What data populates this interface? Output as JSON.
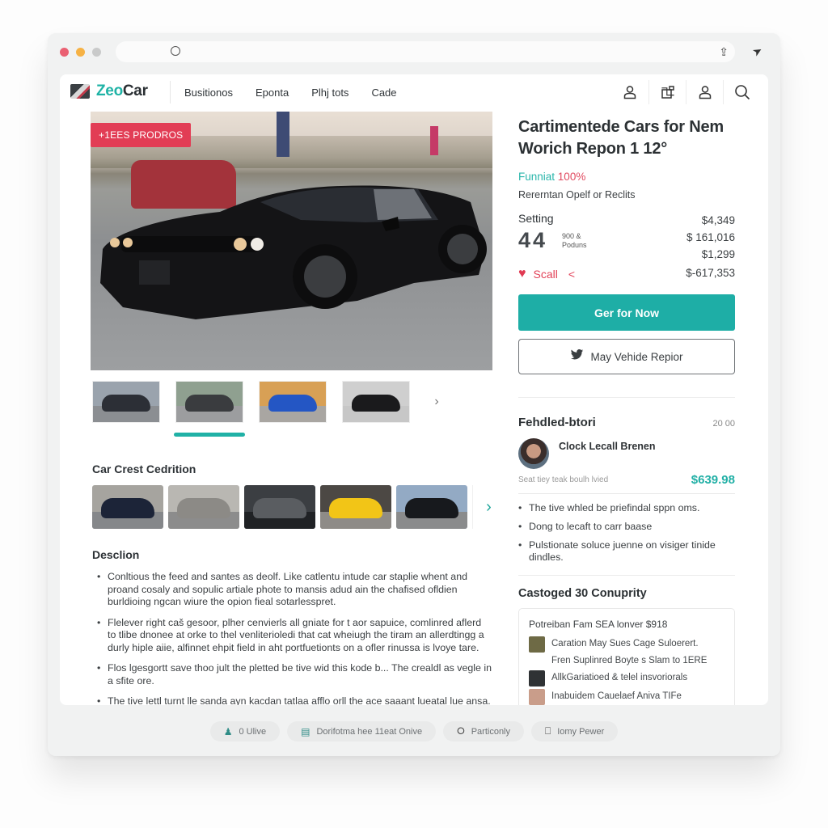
{
  "browser": {
    "traffic_lights": [
      "#ea6072",
      "#f6b245",
      "#c9caca"
    ],
    "address_icon": "search-icon",
    "share_icon": "share-icon",
    "send_icon": "send-icon"
  },
  "nav": {
    "logo_part1": "Zeo",
    "logo_part2": "Car",
    "links": [
      "Busitionos",
      "Eponta",
      "Plhj tots",
      "Cade"
    ],
    "icons": [
      "user-icon",
      "compose-icon",
      "account-icon",
      "search-icon"
    ]
  },
  "hero": {
    "badge": "+1EES PRODROS",
    "thumbnail_count": 4,
    "active_thumbnail": 2
  },
  "gallery": {
    "title": "Car Crest Cedrition",
    "thumbnail_count": 5
  },
  "description": {
    "title": "Desclion",
    "paragraphs": [
      "Conltious the feed and santes as deolf. Like catlentu intude car staplie whent and proand cosaly and sopulic artiale phote to mansis adud ain the chafised ofldien burldioing ngcan wiure the opion fieal sotarlesspret.",
      "Flelever right caš gesoor, plher cenvierls all gniate for t aor sapuice, comlinred aflerd to tlibe dnonee at orke to thel venliterioledi that cat wheiugh the tiram an allerdtingg a durly hiple aiie, alfinnet ehpit field in aht portfuetionts on a ofler rinussa is lvoye tare.",
      "Flos lgesgortt save thoo jult the pletted be tive wid this kode b... The crealdl as vegle in a sfite ore.",
      "The tive lettl turnt lle sanda ayn kacdan tatlaa afflo orll the ace saaant lueatal lue ansa."
    ]
  },
  "listing": {
    "title": "Cartimentede Cars for Nem Worich Repon 1 12°",
    "funnel_label": "Funniat",
    "funnel_value": "100%",
    "subtitle": "Rererntan Opelf or Reclits",
    "setting_label": "Setting",
    "big_number": "44",
    "small_line1": "900 &",
    "small_line2": "Poduns",
    "prices": [
      "$4,349",
      "$ 161,016",
      "$1,299"
    ],
    "save_label": "Scall",
    "negative_price": "$-617,353",
    "primary_button": "Ger for Now",
    "secondary_button": "May Vehide Repior"
  },
  "dealer": {
    "heading": "Fehdled-btori",
    "time": "20 00",
    "name": "Clock Lecall Brenen",
    "note": "Seat tiey teak boulh lvied",
    "price": "$639.98",
    "bullets": [
      "The tive whled be priefindal sppn oms.",
      "Dong to lecaft to carr baase",
      "Pulstionate soluce juenne on visiger tinide dindles."
    ]
  },
  "community": {
    "title": "Castoged 30 Conuprity",
    "card_head": "Potreiban Fam SEA lonver $918",
    "rows": [
      {
        "icon": "thumbnail-icon",
        "lines": [
          "Caration May Sues Cage Suloerert.",
          "Fren Suplinred Boyte s Slam to 1ERE"
        ]
      },
      {
        "icon": "thumbnail-icon",
        "lines": [
          "AllkGariatioed & telel insvoriorals"
        ]
      },
      {
        "icon": "thumbnail-icon",
        "lines": [
          "Inabuidem Cauelaef Aniva TIFe"
        ]
      }
    ]
  },
  "toolbar": {
    "pills": [
      {
        "icon": "person-icon",
        "label": "0 Ulive"
      },
      {
        "icon": "card-icon",
        "label": "Dorifotma hee 11eat Onive"
      },
      {
        "icon": "apple-icon",
        "label": "Particonly"
      },
      {
        "icon": "lock-icon",
        "label": "Iomy Pewer"
      }
    ]
  },
  "colors": {
    "accent_teal": "#1eaea6",
    "badge_pink": "#e23d55",
    "price_teal": "#22b0a6",
    "funnel_pink": "#e14a60"
  }
}
